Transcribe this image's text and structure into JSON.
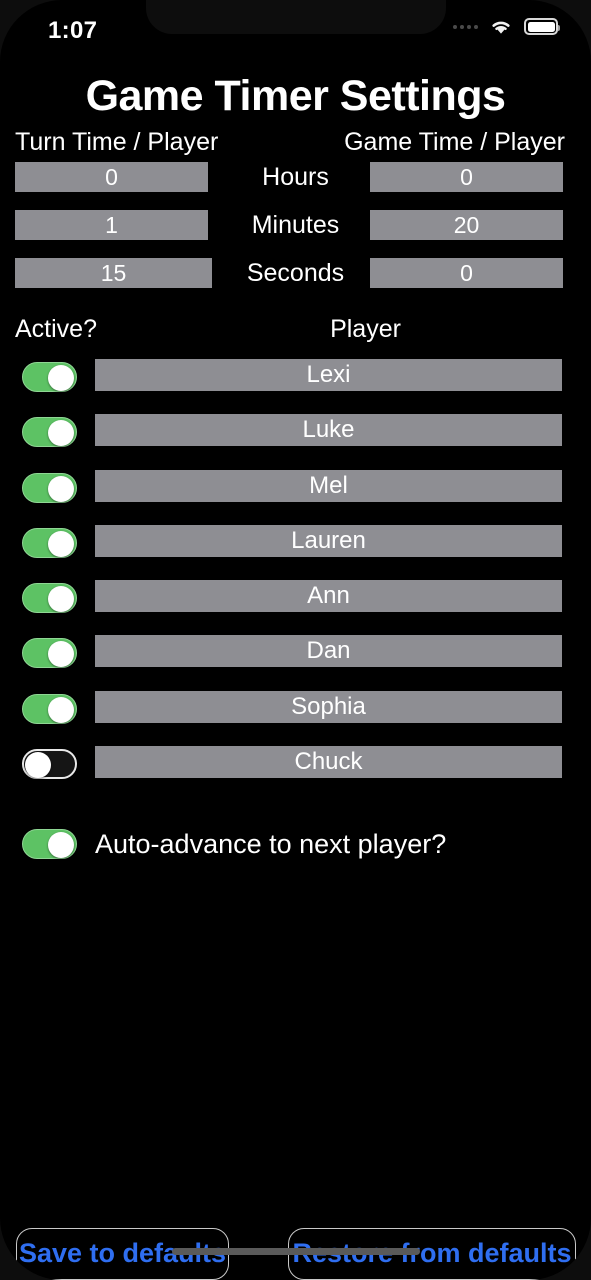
{
  "status_bar": {
    "time": "1:07",
    "cellular_icon": "signal-dots-icon",
    "wifi_icon": "wifi-icon",
    "battery_icon": "battery-full-icon"
  },
  "header": {
    "title": "Game Timer Settings"
  },
  "time_section": {
    "left_column_label": "Turn Time / Player",
    "right_column_label": "Game Time / Player",
    "rows": [
      {
        "unit": "Hours",
        "turn_value": "0",
        "game_value": "0"
      },
      {
        "unit": "Minutes",
        "turn_value": "1",
        "game_value": "20"
      },
      {
        "unit": "Seconds",
        "turn_value": "15",
        "game_value": "0"
      }
    ]
  },
  "player_section": {
    "active_header": "Active?",
    "player_header": "Player",
    "players": [
      {
        "name": "Lexi",
        "active": true
      },
      {
        "name": "Luke",
        "active": true
      },
      {
        "name": "Mel",
        "active": true
      },
      {
        "name": "Lauren",
        "active": true
      },
      {
        "name": "Ann",
        "active": true
      },
      {
        "name": "Dan",
        "active": true
      },
      {
        "name": "Sophia",
        "active": true
      },
      {
        "name": "Chuck",
        "active": false
      }
    ]
  },
  "auto_advance": {
    "label": "Auto-advance to next player?",
    "enabled": true
  },
  "footer": {
    "save_label": "Save to defaults",
    "restore_label": "Restore from defaults"
  },
  "colors": {
    "background": "#000000",
    "field_gray": "#8e8e93",
    "toggle_on_green": "#5dc264",
    "button_blue": "#2f6ef0",
    "text_white": "#ffffff"
  }
}
